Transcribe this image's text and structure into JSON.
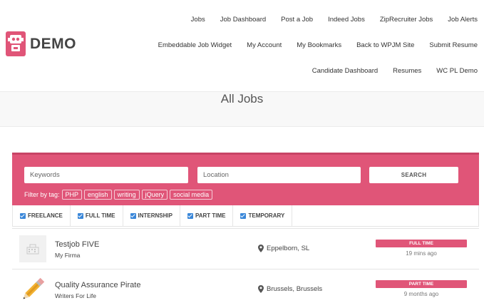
{
  "brand": {
    "name": "DEMO",
    "accent": "#e05578"
  },
  "nav": {
    "row1": [
      "Jobs",
      "Job Dashboard",
      "Post a Job",
      "Indeed Jobs",
      "ZipRecruiter Jobs",
      "Job Alerts"
    ],
    "row2": [
      "Embeddable Job Widget",
      "My Account",
      "My Bookmarks",
      "Back to WPJM Site",
      "Submit Resume"
    ],
    "row3": [
      "Candidate Dashboard",
      "Resumes",
      "WC PL Demo"
    ]
  },
  "page": {
    "title": "All Jobs"
  },
  "search": {
    "keywords_placeholder": "Keywords",
    "location_placeholder": "Location",
    "button_label": "SEARCH",
    "filter_label": "Filter by tag:",
    "tags": [
      "PHP",
      "english",
      "writing",
      "jQuery",
      "social media"
    ]
  },
  "filters": [
    "FREELANCE",
    "FULL TIME",
    "INTERNSHIP",
    "PART TIME",
    "TEMPORARY"
  ],
  "jobs": [
    {
      "title": "Testjob FIVE",
      "company": "My Firma",
      "location": "Eppelborn, SL",
      "type": "FULL TIME",
      "posted": "19 mins ago",
      "thumb_icon": "building-placeholder-icon"
    },
    {
      "title": "Quality Assurance Pirate",
      "company": "Writers For Life",
      "location": "Brussels, Brussels",
      "type": "PART TIME",
      "posted": "9 months ago",
      "thumb_icon": "pencil-icon"
    }
  ]
}
